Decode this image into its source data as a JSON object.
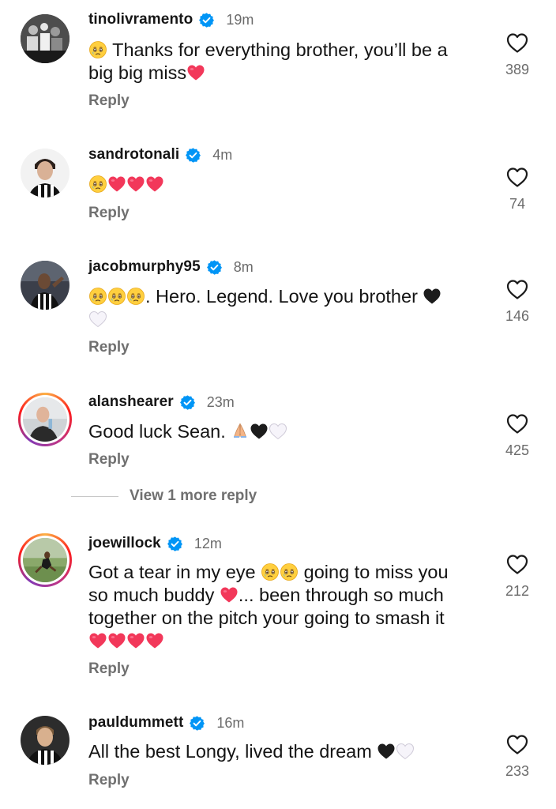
{
  "comments": [
    {
      "username": "tinolivramento",
      "time": "19m",
      "text_parts": [
        "Thanks for everything brother, you’ll be a",
        "big big miss"
      ],
      "reply_label": "Reply",
      "likes": "389"
    },
    {
      "username": "sandrotonali",
      "time": "4m",
      "reply_label": "Reply",
      "likes": "74"
    },
    {
      "username": "jacobmurphy95",
      "time": "8m",
      "text_parts": [
        ". Hero. Legend. Love you brother"
      ],
      "reply_label": "Reply",
      "likes": "146"
    },
    {
      "username": "alanshearer",
      "time": "23m",
      "text_parts": [
        "Good luck Sean."
      ],
      "reply_label": "Reply",
      "likes": "425",
      "view_more": "View 1 more reply"
    },
    {
      "username": "joewillock",
      "time": "12m",
      "text_parts": [
        "Got a tear in my eye",
        "going to miss you",
        "so much buddy",
        "... been through so much",
        "together on the pitch your going to smash it"
      ],
      "reply_label": "Reply",
      "likes": "212"
    },
    {
      "username": "pauldummett",
      "time": "16m",
      "text_parts": [
        "All the best Longy, lived the dream"
      ],
      "reply_label": "Reply",
      "likes": "233"
    }
  ],
  "colors": {
    "verified": "#0095f6",
    "heart_red": "#f2385a",
    "username": "#161616",
    "secondary": "#6b6b6b"
  },
  "icons": {
    "verified": "verified-badge-icon",
    "like": "heart-outline-icon",
    "emoji_tear": "face-holding-back-tears-icon",
    "emoji_red_heart": "red-heart-icon",
    "emoji_black_heart": "black-heart-icon",
    "emoji_white_heart": "white-heart-icon",
    "emoji_pray": "folded-hands-icon"
  }
}
